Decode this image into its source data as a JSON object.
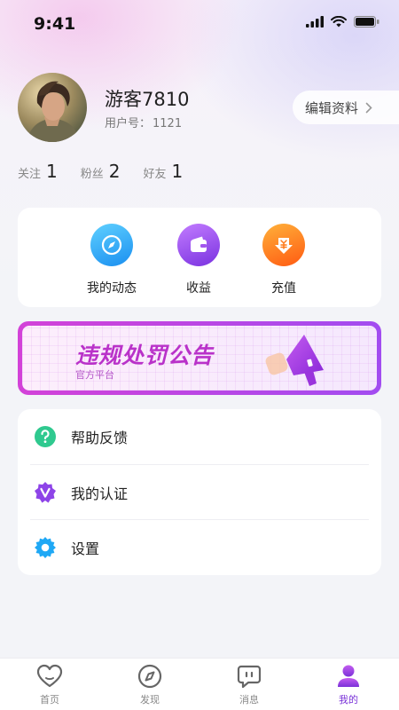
{
  "status_bar": {
    "time": "9:41"
  },
  "profile": {
    "name": "游客7810",
    "id_label": "用户号：",
    "id_value": "1121",
    "edit_label": "编辑资料"
  },
  "stats": [
    {
      "label": "关注",
      "value": "1"
    },
    {
      "label": "粉丝",
      "value": "2"
    },
    {
      "label": "好友",
      "value": "1"
    }
  ],
  "quick_actions": [
    {
      "label": "我的动态",
      "icon": "compass-icon",
      "color": "#1fa8f5"
    },
    {
      "label": "收益",
      "icon": "wallet-icon",
      "color": "#8e44e8"
    },
    {
      "label": "充值",
      "icon": "yuan-download-icon",
      "color": "#ff7a1a"
    }
  ],
  "banner": {
    "title": "违规处罚公告",
    "subtitle": "官方平台"
  },
  "menu": [
    {
      "label": "帮助反馈",
      "icon": "help-icon",
      "color": "#2fc98f"
    },
    {
      "label": "我的认证",
      "icon": "verified-badge-icon",
      "color": "#8e44e8"
    },
    {
      "label": "设置",
      "icon": "gear-icon",
      "color": "#1fa8f5"
    }
  ],
  "tabs": [
    {
      "label": "首页",
      "icon": "heart-icon",
      "active": false
    },
    {
      "label": "发现",
      "icon": "compass-icon",
      "active": false
    },
    {
      "label": "消息",
      "icon": "chat-icon",
      "active": false
    },
    {
      "label": "我的",
      "icon": "user-icon",
      "active": true
    }
  ],
  "colors": {
    "accent": "#7a32d8",
    "banner_border": "#c645d8"
  }
}
